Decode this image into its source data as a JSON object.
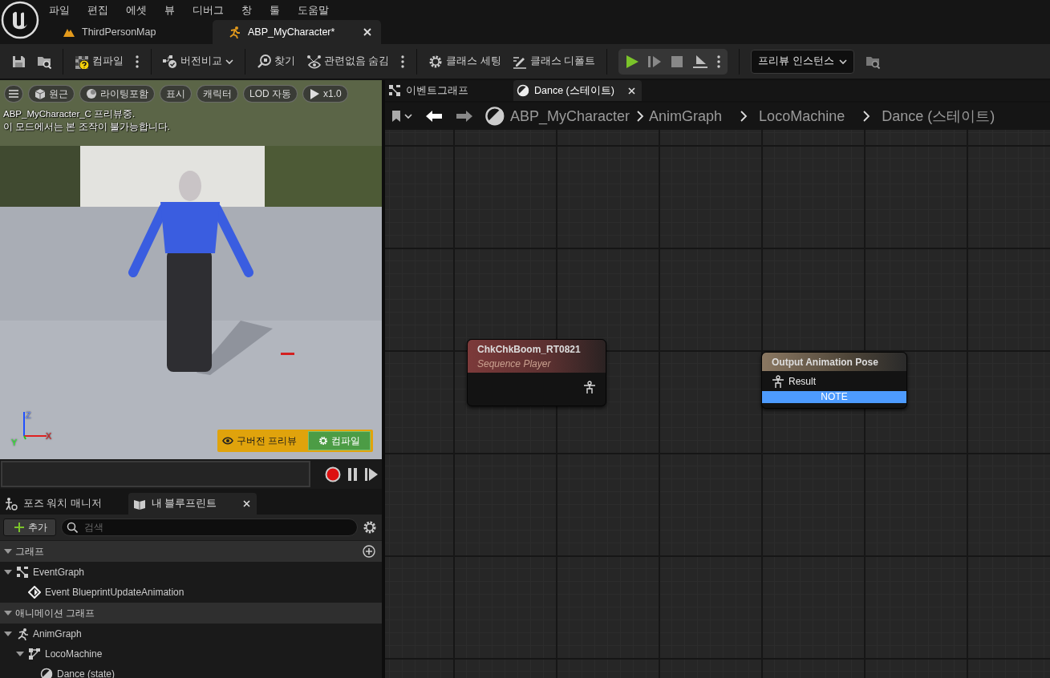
{
  "menu": [
    "파일",
    "편집",
    "에셋",
    "뷰",
    "디버그",
    "창",
    "툴",
    "도움말"
  ],
  "doc_tabs": [
    {
      "label": "ThirdPersonMap",
      "selected": false,
      "kind": "map"
    },
    {
      "label": "ABP_MyCharacter*",
      "selected": true,
      "kind": "anim"
    }
  ],
  "toolbar": [
    [
      {
        "kind": "icon"
      },
      {
        "kind": "icon"
      }
    ],
    [
      {
        "label": "컴파일",
        "kind": "button",
        "more": true
      }
    ],
    [
      {
        "label": "버전비교",
        "kind": "dropdown"
      }
    ],
    [
      {
        "label": "찾기",
        "kind": "button"
      },
      {
        "label": "관련없음 숨김",
        "kind": "button",
        "more": true
      }
    ],
    [
      {
        "label": "클래스 세팅",
        "kind": "button"
      },
      {
        "label": "클래스 디폴트",
        "kind": "button"
      }
    ],
    [
      {
        "kind": "play"
      }
    ],
    [
      {
        "label": "프리뷰 인스턴스",
        "kind": "select"
      },
      {
        "kind": "icon"
      }
    ]
  ],
  "viewport": {
    "chips": [
      "원근",
      "라이팅포함",
      "표시",
      "캐릭터",
      "LOD 자동",
      "x1.0"
    ],
    "messages": [
      "ABP_MyCharacter_C 프리뷰중.",
      "이 모드에서는 본 조작이 불가능합니다."
    ],
    "axis_labels": [
      "Z",
      "X",
      "Y"
    ],
    "banner": {
      "label": "구버전 프리뷰",
      "button": "컴파일"
    }
  },
  "panel_tabs": [
    {
      "label": "포즈 워치 매니저",
      "selected": false
    },
    {
      "label": "내 블루프린트",
      "selected": true
    }
  ],
  "add_button": "추가",
  "search": {
    "placeholder": "검색"
  },
  "tree": [
    {
      "title": "그래프",
      "expanded": true,
      "add": true,
      "items": [
        {
          "label": "EventGraph",
          "kind": "graph",
          "expanded": true,
          "children": [
            {
              "label": "Event BlueprintUpdateAnimation",
              "kind": "event"
            }
          ]
        }
      ]
    },
    {
      "title": "애니메이션 그래프",
      "expanded": true,
      "add": false,
      "items": [
        {
          "label": "AnimGraph",
          "kind": "anim",
          "expanded": true,
          "children": [
            {
              "label": "LocoMachine",
              "kind": "machine",
              "expanded": true,
              "children": [
                {
                  "label": "Dance (state)",
                  "kind": "state"
                }
              ]
            }
          ]
        }
      ]
    }
  ],
  "graph_tabs": [
    {
      "label": "이벤트그래프",
      "selected": false
    },
    {
      "label": "Dance (스테이트)",
      "selected": true
    }
  ],
  "breadcrumb": [
    "ABP_MyCharacter",
    "AnimGraph",
    "LocoMachine",
    "Dance (스테이트)"
  ],
  "nodes": [
    {
      "kind": "sequence",
      "title": "ChkChkBoom_RT0821",
      "subtitle": "Sequence Player"
    },
    {
      "kind": "output",
      "title": "Output Animation Pose",
      "pins": [
        "Result"
      ],
      "note": "NOTE"
    }
  ]
}
